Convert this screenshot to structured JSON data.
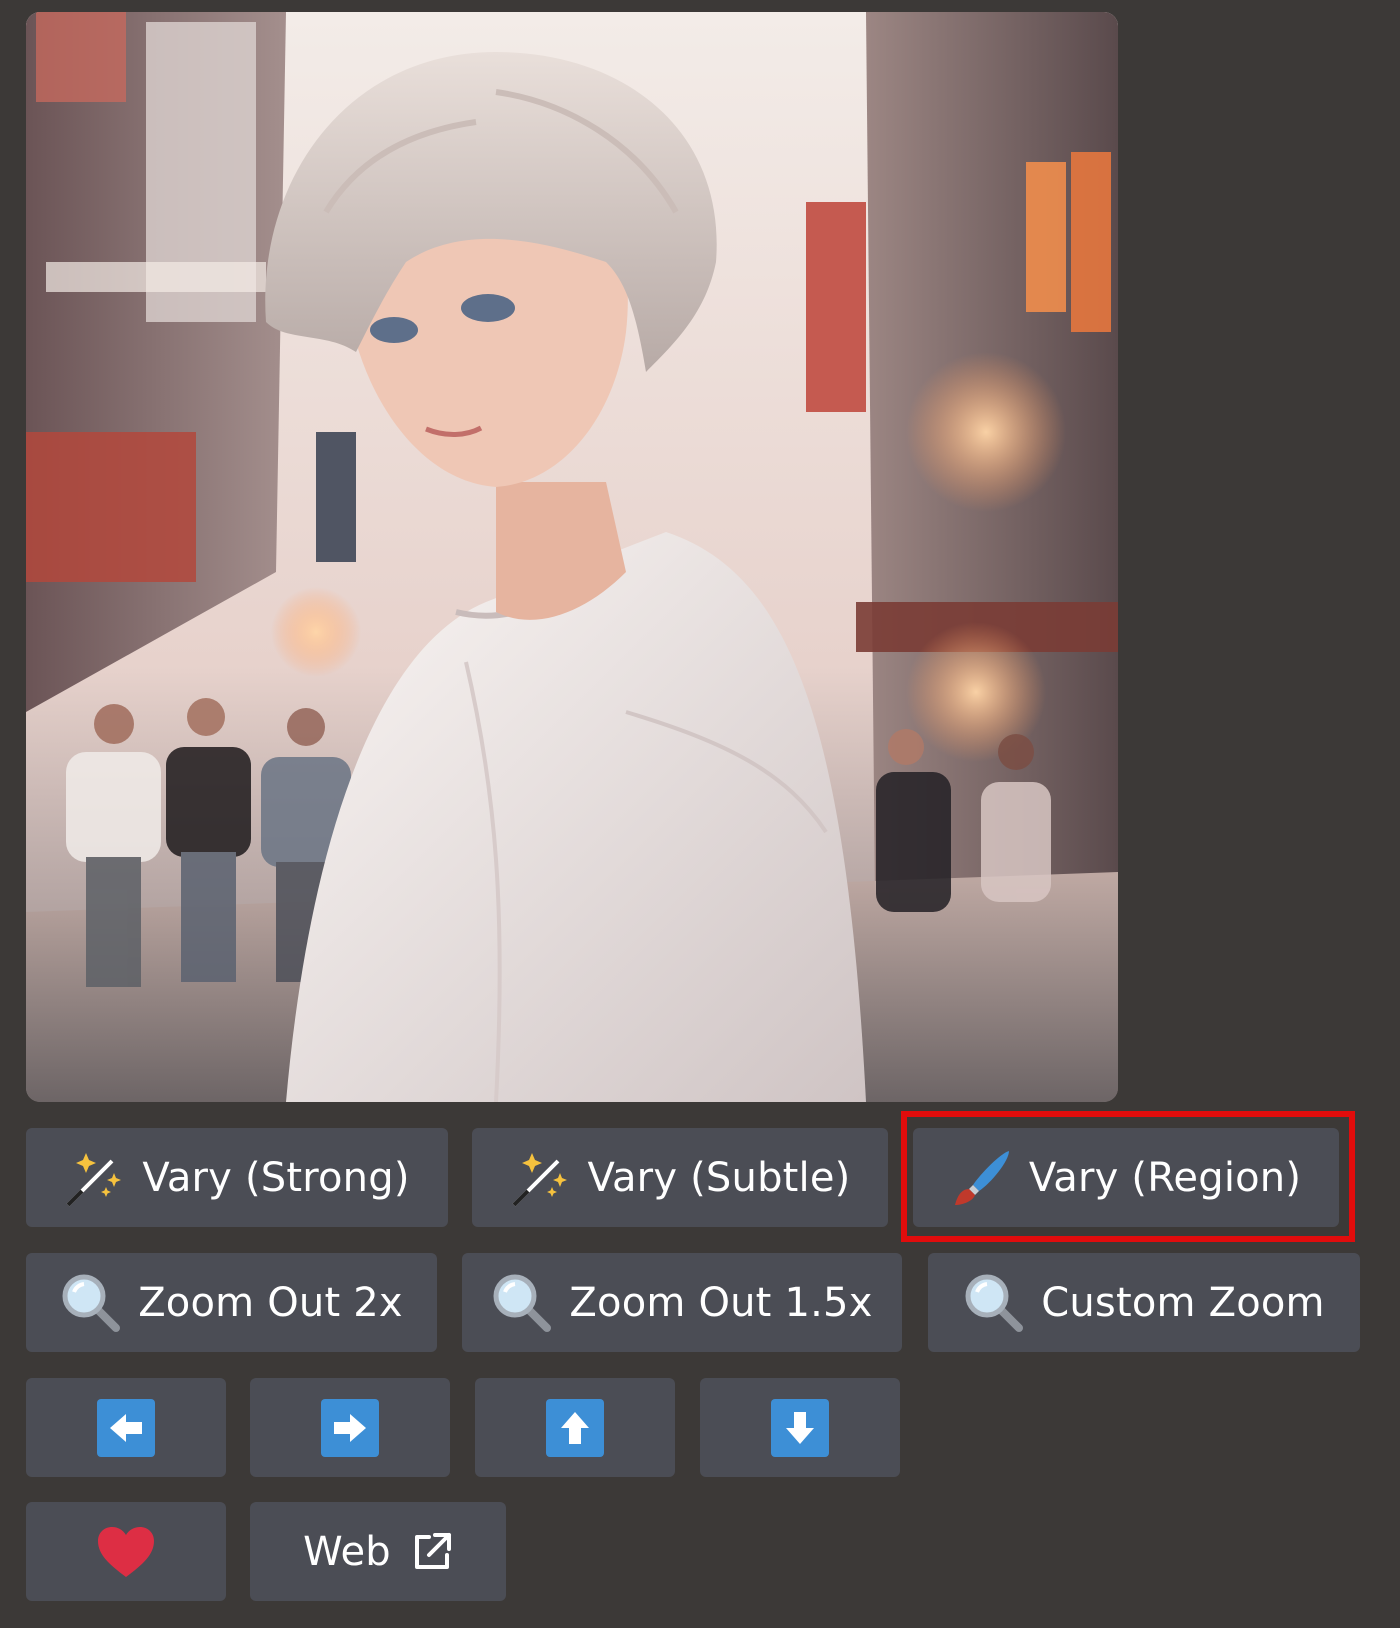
{
  "image": {
    "alt": "anime portrait: silver-haired young man in white shirt on a sunlit city street"
  },
  "buttons": {
    "vary_strong": "Vary (Strong)",
    "vary_subtle": "Vary (Subtle)",
    "vary_region": "Vary (Region)",
    "zoom_out_2x": "Zoom Out 2x",
    "zoom_out_1_5x": "Zoom Out 1.5x",
    "custom_zoom": "Custom Zoom",
    "web": "Web"
  },
  "icons": {
    "vary_strong": "magic-wand-icon",
    "vary_subtle": "magic-wand-icon",
    "vary_region": "paintbrush-icon",
    "zoom": "magnifier-icon",
    "pan_left": "arrow-left-icon",
    "pan_right": "arrow-right-icon",
    "pan_up": "arrow-up-icon",
    "pan_down": "arrow-down-icon",
    "favorite": "heart-icon",
    "web": "external-link-icon"
  },
  "colors": {
    "background": "#3c3937",
    "button": "#4b4d55",
    "highlight": "#e10c0c",
    "arrow_tile": "#3d8fd6",
    "heart": "#dd2e44"
  }
}
